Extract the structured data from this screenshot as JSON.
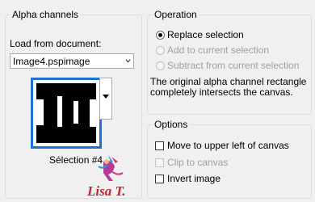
{
  "alpha_channels": {
    "title": "Alpha channels",
    "load_label": "Load from document:",
    "document_value": "Image4.pspimage",
    "selection_label": "Sélection #4"
  },
  "operation": {
    "title": "Operation",
    "options": [
      {
        "label": "Replace selection",
        "selected": true,
        "enabled": true
      },
      {
        "label": "Add to current selection",
        "selected": false,
        "enabled": false
      },
      {
        "label": "Subtract from current selection",
        "selected": false,
        "enabled": false
      }
    ],
    "description": "The original alpha channel rectangle completely intersects the canvas."
  },
  "options": {
    "title": "Options",
    "move_upper_left": "Move to upper left of canvas",
    "clip_to_canvas": "Clip to canvas",
    "invert_image": "Invert image"
  },
  "watermark": {
    "text": "Lisa T."
  },
  "colors": {
    "thumb_border": "#1e72d6",
    "watermark_red": "#c0282d"
  }
}
